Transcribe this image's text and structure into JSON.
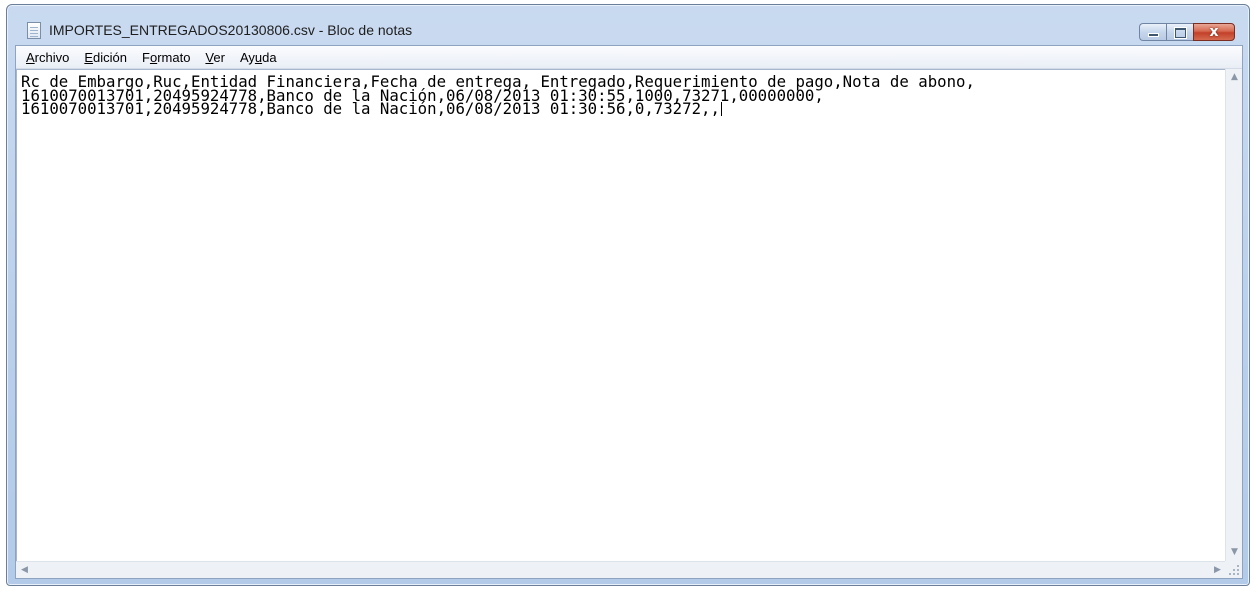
{
  "window": {
    "title": "IMPORTES_ENTREGADOS20130806.csv - Bloc de notas",
    "icon": "notepad-icon",
    "controls": {
      "minimize": "minimize-icon",
      "maximize": "maximize-icon",
      "close": "x"
    }
  },
  "menu": {
    "archivo": {
      "accel": "A",
      "rest": "rchivo"
    },
    "edicion": {
      "accel": "E",
      "rest": "dición"
    },
    "formato": {
      "pre": "F",
      "accel": "o",
      "rest": "rmato"
    },
    "ver": {
      "accel": "V",
      "rest": "er"
    },
    "ayuda": {
      "pre": "Ay",
      "accel": "u",
      "rest": "da"
    }
  },
  "editor": {
    "lines": [
      "Rc de Embargo,Ruc,Entidad Financiera,Fecha de entrega, Entregado,Requerimiento de pago,Nota de abono,",
      "1610070013701,20495924778,Banco de la Nación,06/08/2013 01:30:55,1000,73271,00000000,",
      "1610070013701,20495924778,Banco de la Nación,06/08/2013 01:30:56,0,73272,,"
    ]
  },
  "scrollbars": {
    "up_arrow": "▲",
    "down_arrow": "▼",
    "left_arrow": "◀",
    "right_arrow": "▶"
  }
}
